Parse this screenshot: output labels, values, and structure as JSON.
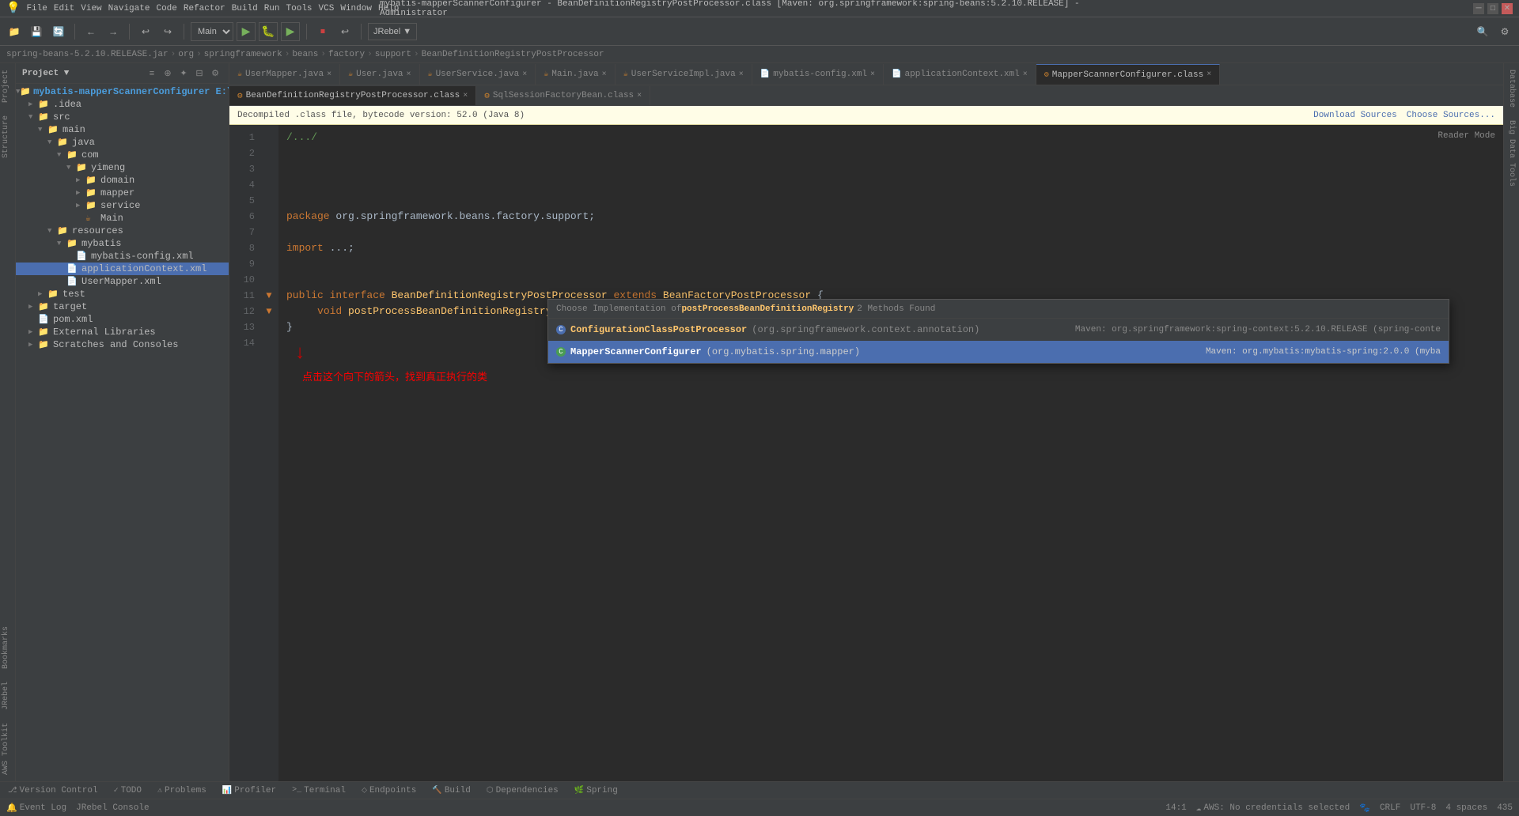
{
  "titlebar": {
    "title": "mybatis-mapperScannerConfigurer - BeanDefinitionRegistryPostProcessor.class [Maven: org.springframework:spring-beans:5.2.10.RELEASE] - Administrator",
    "controls": [
      "minimize",
      "maximize",
      "close"
    ]
  },
  "menubar": {
    "items": [
      "File",
      "Edit",
      "View",
      "Navigate",
      "Code",
      "Refactor",
      "Build",
      "Run",
      "Tools",
      "VCS",
      "Window",
      "Help"
    ]
  },
  "toolbar": {
    "main_selector": "Main",
    "jrebel_label": "JRebel ▼"
  },
  "breadcrumb": {
    "items": [
      "spring-beans-5.2.10.RELEASE.jar",
      "org",
      "springframework",
      "beans",
      "factory",
      "support",
      "BeanDefinitionRegistryPostProcessor"
    ]
  },
  "project": {
    "header": "Project ▼",
    "root": "mybatis-mapperScannerConfigurer E:\\myb...",
    "tree": [
      {
        "indent": 0,
        "type": "folder",
        "label": ".idea",
        "expanded": false
      },
      {
        "indent": 0,
        "type": "folder",
        "label": "src",
        "expanded": true
      },
      {
        "indent": 1,
        "type": "folder",
        "label": "main",
        "expanded": true
      },
      {
        "indent": 2,
        "type": "folder",
        "label": "java",
        "expanded": true
      },
      {
        "indent": 3,
        "type": "folder",
        "label": "com",
        "expanded": true
      },
      {
        "indent": 4,
        "type": "folder",
        "label": "yimeng",
        "expanded": true
      },
      {
        "indent": 5,
        "type": "folder",
        "label": "domain",
        "expanded": false
      },
      {
        "indent": 5,
        "type": "folder",
        "label": "mapper",
        "expanded": false
      },
      {
        "indent": 5,
        "type": "folder",
        "label": "service",
        "expanded": false
      },
      {
        "indent": 5,
        "type": "java",
        "label": "Main",
        "expanded": false
      },
      {
        "indent": 2,
        "type": "folder",
        "label": "resources",
        "expanded": true
      },
      {
        "indent": 3,
        "type": "folder",
        "label": "mybatis",
        "expanded": true
      },
      {
        "indent": 4,
        "type": "xml",
        "label": "mybatis-config.xml",
        "selected": false
      },
      {
        "indent": 3,
        "type": "xml",
        "label": "applicationContext.xml",
        "selected": true
      },
      {
        "indent": 3,
        "type": "xml",
        "label": "UserMapper.xml",
        "selected": false
      },
      {
        "indent": 1,
        "type": "folder",
        "label": "test",
        "expanded": false
      },
      {
        "indent": 0,
        "type": "folder",
        "label": "target",
        "expanded": false
      },
      {
        "indent": 0,
        "type": "xml",
        "label": "pom.xml",
        "expanded": false
      },
      {
        "indent": 0,
        "type": "folder",
        "label": "External Libraries",
        "expanded": false
      },
      {
        "indent": 0,
        "type": "folder",
        "label": "Scratches and Consoles",
        "expanded": false
      }
    ]
  },
  "tabs": {
    "main_tabs": [
      "UserMapper.java",
      "User.java",
      "UserService.java",
      "Main.java",
      "UserServiceImpl.java",
      "mybatis-config.xml",
      "applicationContext.xml",
      "MapperScannerConfigurer.class"
    ],
    "active_main_tab": "MapperScannerConfigurer.class",
    "sub_tabs": [
      "BeanDefinitionRegistryPostProcessor.class",
      "SqlSessionFactoryBean.class"
    ],
    "active_sub_tab": "BeanDefinitionRegistryPostProcessor.class"
  },
  "decompile_bar": {
    "text": "Decompiled .class file, bytecode version: 52.0 (Java 8)",
    "download_sources": "Download Sources",
    "choose_sources": "Choose Sources...",
    "reader_mode": "Reader Mode"
  },
  "code": {
    "lines": [
      {
        "num": "1",
        "gutter": "",
        "content": "/.../",
        "style": "comment"
      },
      {
        "num": "5",
        "gutter": "",
        "content": ""
      },
      {
        "num": "6",
        "gutter": "",
        "content": "package org.springframework.beans.factory.support;"
      },
      {
        "num": "7",
        "gutter": "",
        "content": ""
      },
      {
        "num": "8",
        "gutter": "",
        "content": "import ...;"
      },
      {
        "num": "9",
        "gutter": "",
        "content": ""
      },
      {
        "num": "10",
        "gutter": "",
        "content": ""
      },
      {
        "num": "11",
        "gutter": "▼",
        "content": "public interface BeanDefinitionRegistryPostProcessor extends BeanFactoryPostProcessor {"
      },
      {
        "num": "12",
        "gutter": "▼",
        "content": "    void postProcessBeanDefinitionRegistry(BeanDefinitionRegistry var1) throws BeansException;"
      },
      {
        "num": "13",
        "gutter": "",
        "content": "}"
      },
      {
        "num": "14",
        "gutter": "",
        "content": ""
      }
    ]
  },
  "impl_popup": {
    "header_prefix": "Choose Implementation of ",
    "method_name": "postProcessBeanDefinitionRegistry",
    "methods_found": "2 Methods Found",
    "items": [
      {
        "circle": "C",
        "circle_color": "blue",
        "class_name": "ConfigurationClassPostProcessor",
        "package": "(org.springframework.context.annotation)",
        "maven": "Maven: org.springframework:spring-context:5.2.10.RELEASE (spring-conte",
        "selected": false
      },
      {
        "circle": "C",
        "circle_color": "green",
        "class_name": "MapperScannerConfigurer",
        "package": "(org.mybatis.spring.mapper)",
        "maven": "Maven: org.mybatis:mybatis-spring:2.0.0 (myba",
        "selected": true
      }
    ]
  },
  "annotation": {
    "chinese_text": "点击这个向下的箭头，找到真正执行的类",
    "arrow_direction": "↓"
  },
  "bottom_tabs": {
    "items": [
      "Version Control",
      "TODO",
      "Problems",
      "Profiler",
      "Terminal",
      "Endpoints",
      "Build",
      "Dependencies",
      "Spring"
    ]
  },
  "statusbar": {
    "left": [
      "Event Log",
      "JRebel Console"
    ],
    "right": {
      "position": "14:1",
      "aws": "AWS: No credentials selected",
      "encoding": "CRLF",
      "charset": "UTF-8",
      "indent": "4 spaces",
      "column": "435"
    }
  },
  "vertical_tabs": {
    "left": [
      "Project",
      "Structure",
      "Bookmarks",
      "JRebel",
      "AWS Toolkit"
    ],
    "right": [
      "Database",
      "Big Data Tools"
    ]
  }
}
